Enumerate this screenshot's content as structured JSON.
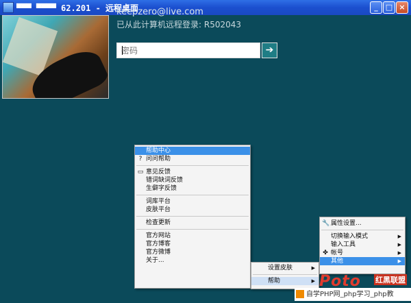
{
  "window": {
    "title": "▀▀▀ ▀▀▀▀ 62.201 - 远程桌面",
    "minimize": "_",
    "maximize": "□",
    "close": "×"
  },
  "login": {
    "email": "keepzero@live.com",
    "last_login": "已从此计算机远程登录: R502043",
    "password_placeholder": "密码",
    "submit_icon": "arrow-right"
  },
  "context_menu": {
    "items": [
      {
        "label": "帮助中心"
      },
      {
        "label": "问问帮助",
        "icon": "question-icon"
      },
      {
        "label": "意见反馈",
        "icon": "speech-bubble-icon"
      },
      {
        "label": "错词缺词反馈"
      },
      {
        "label": "生僻字反馈"
      },
      {
        "label": "词库平台"
      },
      {
        "label": "皮肤平台"
      },
      {
        "label": "检查更新"
      },
      {
        "label": "官方网站"
      },
      {
        "label": "官方博客"
      },
      {
        "label": "官方微博"
      },
      {
        "label": "关于..."
      }
    ]
  },
  "submenu_skin": {
    "items": [
      {
        "label": "设置皮肤"
      },
      {
        "label": "帮助"
      }
    ]
  },
  "tray_menu": {
    "items": [
      {
        "label": "属性设置...",
        "icon": "wrench-icon"
      },
      {
        "label": "切换输入模式"
      },
      {
        "label": "输入工具"
      },
      {
        "label": "帐号",
        "icon": "account-icon"
      },
      {
        "label": "其他"
      }
    ]
  },
  "watermark": {
    "logo": "Poto",
    "brand": "红黑联盟",
    "line": "自学PHP网_php学习_php教"
  },
  "colors": {
    "background": "#0b4a5a",
    "highlight": "#3b90e8",
    "submit": "#1f7d85"
  }
}
